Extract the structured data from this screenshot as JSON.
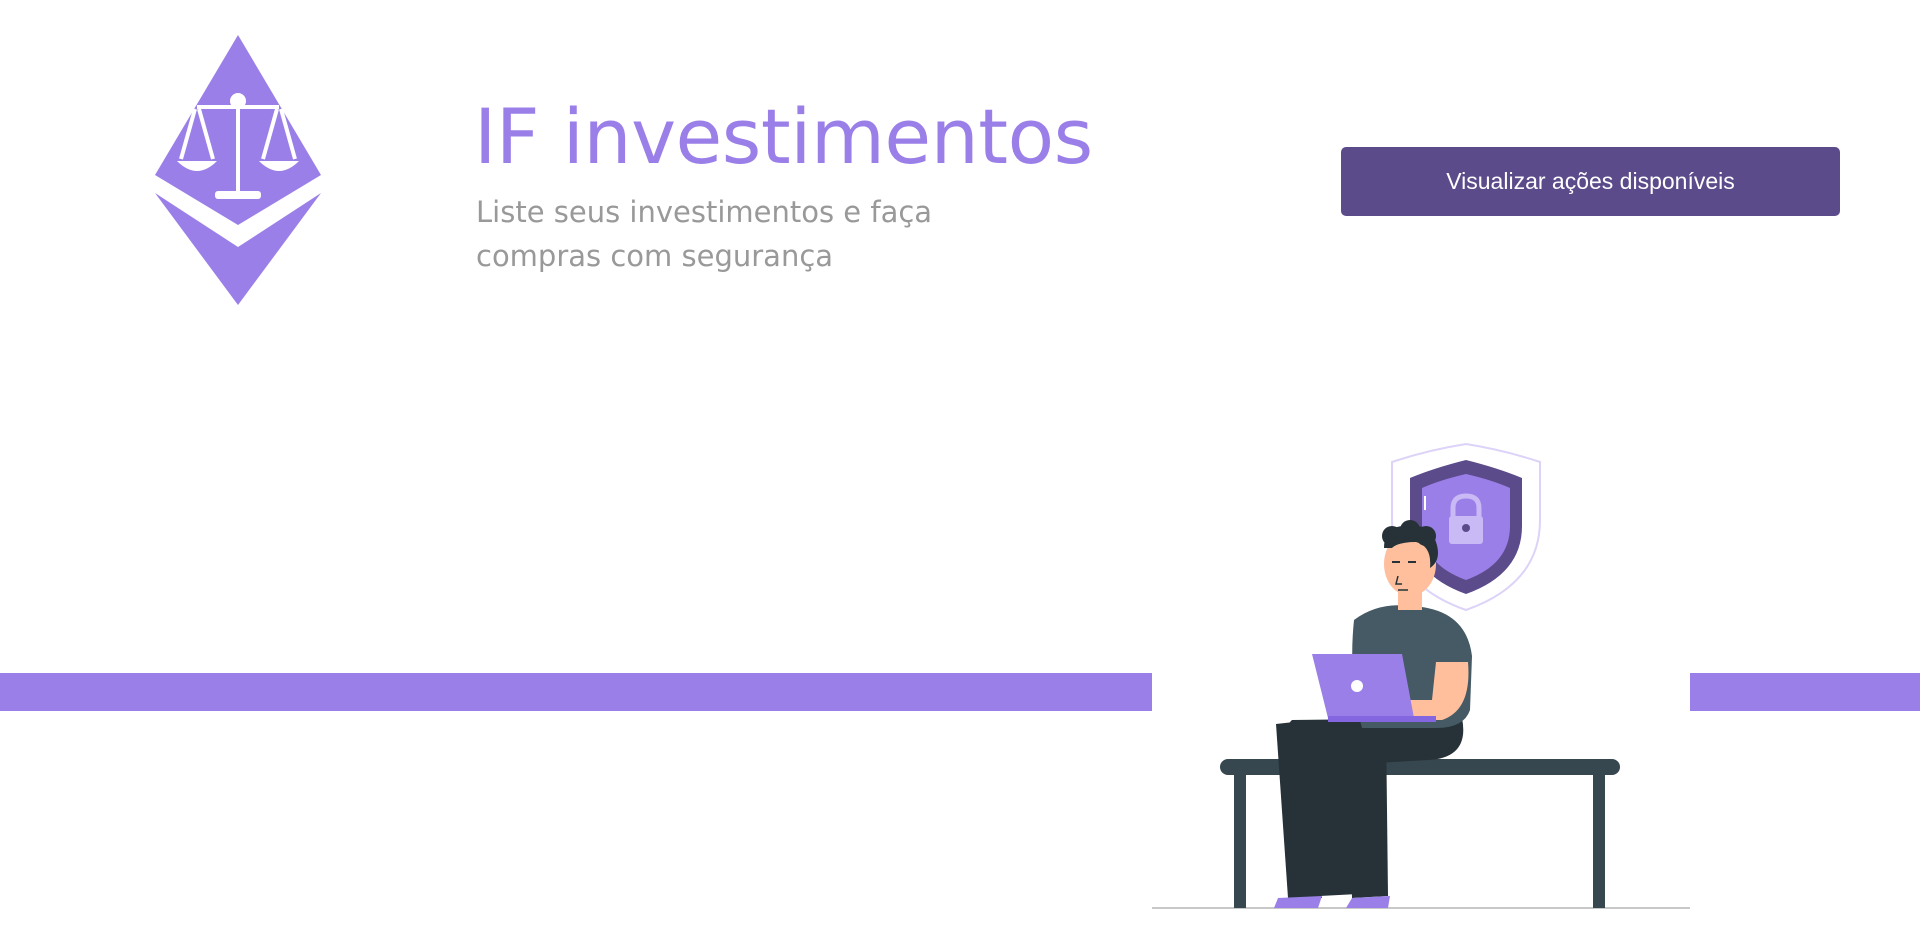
{
  "header": {
    "title": "IF investimentos",
    "subtitle": "Liste seus investimentos e faça compras com segurança",
    "cta_label": "Visualizar ações disponíveis",
    "logo_icon": "scales-of-justice-diamond-icon"
  },
  "hero": {
    "illustration": "person-with-laptop-on-bench-security-shield-illustration"
  },
  "colors": {
    "accent": "#9b7fe8",
    "button": "#5b4b8a",
    "subtitle_text": "#999999",
    "dark": "#263238",
    "shirt": "#455a64",
    "skin": "#ffbf9d"
  }
}
